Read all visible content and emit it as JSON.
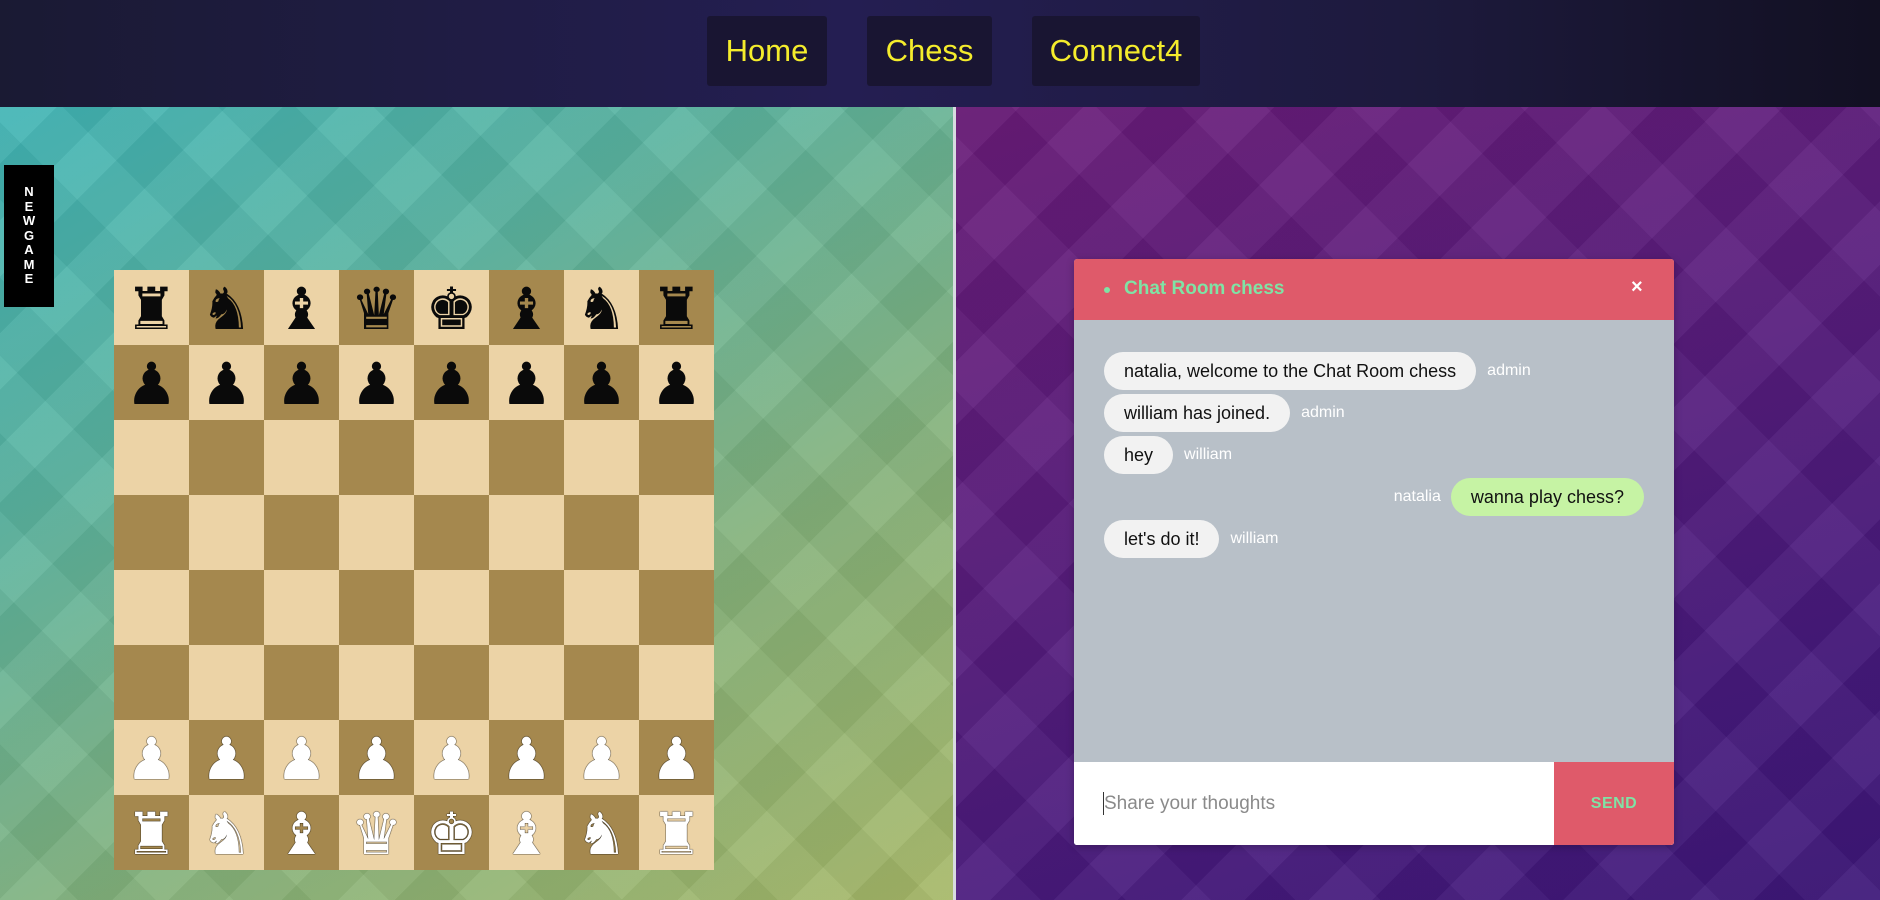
{
  "nav": {
    "items": [
      {
        "label": "Home"
      },
      {
        "label": "Chess"
      },
      {
        "label": "Connect4"
      }
    ]
  },
  "new_game": {
    "label": "NEW GAME"
  },
  "board": {
    "colors": {
      "light": "#ecd3a6",
      "dark": "#a5884e"
    },
    "ranks": [
      [
        "♜",
        "♞",
        "♝",
        "♛",
        "♚",
        "♝",
        "♞",
        "♜"
      ],
      [
        "♟",
        "♟",
        "♟",
        "♟",
        "♟",
        "♟",
        "♟",
        "♟"
      ],
      [
        "",
        "",
        "",
        "",
        "",
        "",
        "",
        ""
      ],
      [
        "",
        "",
        "",
        "",
        "",
        "",
        "",
        ""
      ],
      [
        "",
        "",
        "",
        "",
        "",
        "",
        "",
        ""
      ],
      [
        "",
        "",
        "",
        "",
        "",
        "",
        "",
        ""
      ],
      [
        "♟",
        "♟",
        "♟",
        "♟",
        "♟",
        "♟",
        "♟",
        "♟"
      ],
      [
        "♜",
        "♞",
        "♝",
        "♛",
        "♚",
        "♝",
        "♞",
        "♜"
      ]
    ],
    "piece_colors": [
      "black",
      "black",
      "",
      "",
      "",
      "",
      "white",
      "white"
    ]
  },
  "chat": {
    "title": "Chat Room chess",
    "close": "×",
    "messages": [
      {
        "text": "natalia, welcome to the Chat Room chess",
        "sender": "admin",
        "side": "left"
      },
      {
        "text": "william has joined.",
        "sender": "admin",
        "side": "left"
      },
      {
        "text": "hey",
        "sender": "william",
        "side": "left"
      },
      {
        "text": "wanna play chess?",
        "sender": "natalia",
        "side": "right"
      },
      {
        "text": "let's do it!",
        "sender": "william",
        "side": "left"
      }
    ],
    "input_placeholder": "Share your thoughts",
    "input_value": "",
    "send_label": "SEND",
    "colors": {
      "header": "#df5a6a",
      "accent": "#7fe3a5",
      "own_bubble": "#c6f3a4"
    }
  }
}
